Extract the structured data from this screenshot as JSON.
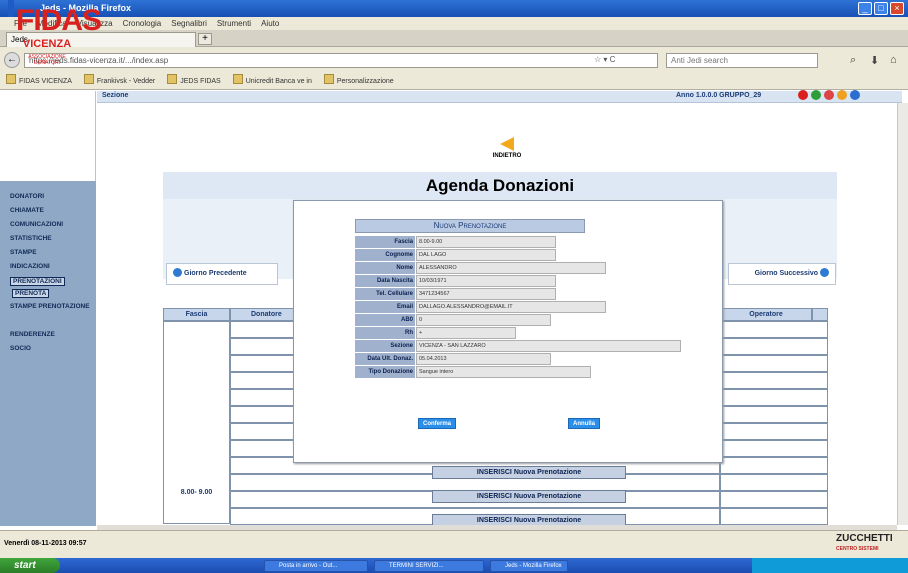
{
  "browser": {
    "title": "Jeds - Mozilla Firefox",
    "menu": [
      "File",
      "Modifica",
      "Visualizza",
      "Cronologia",
      "Segnalibri",
      "Strumenti",
      "Aiuto"
    ],
    "tab_label": "Jeds",
    "new_tab": "+",
    "url": "https://jeds.fidas-vicenza.it/.../index.asp",
    "search_placeholder": "Anti Jedi search",
    "bookmarks": [
      "FIDAS VICENZA",
      "Frankivsk - Vedder",
      "JEDS FIDAS",
      "Unicredit Banca ve in",
      "Personalizzazione"
    ]
  },
  "logo": {
    "name": "FIDAS",
    "city": "VICENZA",
    "subtitle": "ASSOCIAZIONE DONATORI"
  },
  "sidebar": {
    "items": [
      "DONATORI",
      "CHIAMATE",
      "COMUNICAZIONI",
      "STATISTICHE",
      "STAMPE",
      "INDICAZIONI",
      "PRENOTAZIONI",
      "PRENOTA",
      "STAMPE PRENOTAZIONE",
      "RENDERENZE",
      "SOCIO"
    ]
  },
  "header": {
    "left": "Sezione",
    "right": "Anno 1.0.0.0    GRUPPO_29"
  },
  "page": {
    "back_label": "INDIETRO",
    "title": "Agenda Donazioni",
    "prev_day": "Giorno Precedente",
    "next_day": "Giorno Successivo"
  },
  "table": {
    "headers": {
      "fascia": "Fascia",
      "donatore": "Donatore",
      "operatore": "Operatore"
    },
    "time_slot": "8.00- 9.00",
    "insert_button": "INSERISCI Nuova Prenotazione"
  },
  "modal": {
    "title": "Nuova Prenotazione",
    "fields": [
      {
        "label": "Fascia",
        "value": "8.00-9.00"
      },
      {
        "label": "Cognome",
        "value": "DAL LAGO"
      },
      {
        "label": "Nome",
        "value": "ALESSANDRO"
      },
      {
        "label": "Data Nascita",
        "value": "10/03/1971"
      },
      {
        "label": "Tel. Cellulare",
        "value": "3471234567"
      },
      {
        "label": "Email",
        "value": "DALLAGO.ALESSANDRO@EMAIL.IT"
      },
      {
        "label": "AB0",
        "value": "0"
      },
      {
        "label": "Rh",
        "value": "+"
      },
      {
        "label": "Sezione",
        "value": "VICENZA - SAN LAZZARO"
      },
      {
        "label": "Data Ult. Donaz.",
        "value": "05.04.2013"
      },
      {
        "label": "Tipo Donazione",
        "value": "Sangue intero"
      }
    ],
    "confirm": "Conferma",
    "cancel": "Annulla"
  },
  "status": {
    "date": "Venerdì 08-11-2013 09:57",
    "brand": "ZUCCHETTI",
    "brand_sub": "CENTRO SISTEMI"
  },
  "taskbar": {
    "start": "start",
    "tasks": [
      "Posta in arrivo - Out...",
      "TERMINI SERVIZI...",
      "Jeds - Mozilla Firefox"
    ]
  },
  "colors": {
    "accent": "#2f72d6",
    "sidebar": "#8fa8c6",
    "logo_red": "#d8211f",
    "button_blue": "#2b8ee8"
  }
}
